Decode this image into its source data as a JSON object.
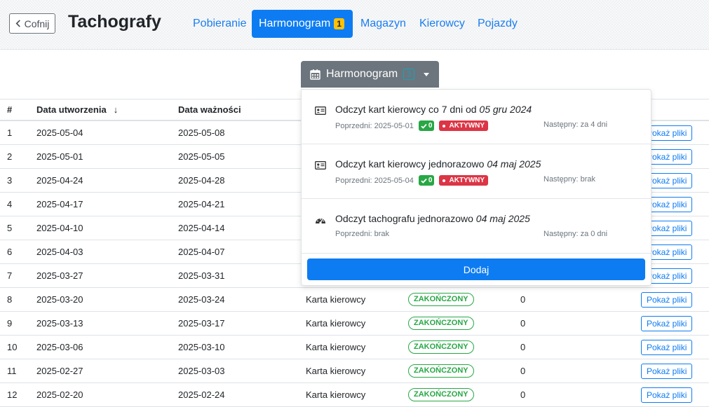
{
  "header": {
    "back_label": "Cofnij",
    "title": "Tachografy",
    "tabs": [
      {
        "label": "Pobieranie"
      },
      {
        "label": "Harmonogram",
        "badge": "1"
      },
      {
        "label": "Magazyn"
      },
      {
        "label": "Kierowcy"
      },
      {
        "label": "Pojazdy"
      }
    ]
  },
  "toolbar": {
    "harmonogram_label": "Harmonogram",
    "harmonogram_count": "3"
  },
  "table": {
    "headers": [
      "#",
      "Data utworzenia",
      "Data ważności"
    ],
    "sort_indicator": "↓",
    "rows": [
      {
        "n": "1",
        "created": "2025-05-04",
        "expires": "2025-05-08",
        "type": "",
        "status": "",
        "count": "",
        "files": "Pokaż pliki"
      },
      {
        "n": "2",
        "created": "2025-05-01",
        "expires": "2025-05-05",
        "type": "",
        "status": "",
        "count": "",
        "files": "Pokaż pliki"
      },
      {
        "n": "3",
        "created": "2025-04-24",
        "expires": "2025-04-28",
        "type": "",
        "status": "",
        "count": "",
        "files": "Pokaż pliki"
      },
      {
        "n": "4",
        "created": "2025-04-17",
        "expires": "2025-04-21",
        "type": "",
        "status": "",
        "count": "",
        "files": "Pokaż pliki"
      },
      {
        "n": "5",
        "created": "2025-04-10",
        "expires": "2025-04-14",
        "type": "",
        "status": "",
        "count": "",
        "files": "Pokaż pliki"
      },
      {
        "n": "6",
        "created": "2025-04-03",
        "expires": "2025-04-07",
        "type": "",
        "status": "",
        "count": "",
        "files": "Pokaż pliki"
      },
      {
        "n": "7",
        "created": "2025-03-27",
        "expires": "2025-03-31",
        "type": "",
        "status": "",
        "count": "",
        "files": "Pokaż pliki"
      },
      {
        "n": "8",
        "created": "2025-03-20",
        "expires": "2025-03-24",
        "type": "Karta kierowcy",
        "status": "ZAKOŃCZONY",
        "count": "0",
        "files": "Pokaż pliki"
      },
      {
        "n": "9",
        "created": "2025-03-13",
        "expires": "2025-03-17",
        "type": "Karta kierowcy",
        "status": "ZAKOŃCZONY",
        "count": "0",
        "files": "Pokaż pliki"
      },
      {
        "n": "10",
        "created": "2025-03-06",
        "expires": "2025-03-10",
        "type": "Karta kierowcy",
        "status": "ZAKOŃCZONY",
        "count": "0",
        "files": "Pokaż pliki"
      },
      {
        "n": "11",
        "created": "2025-02-27",
        "expires": "2025-03-03",
        "type": "Karta kierowcy",
        "status": "ZAKOŃCZONY",
        "count": "0",
        "files": "Pokaż pliki"
      },
      {
        "n": "12",
        "created": "2025-02-20",
        "expires": "2025-02-24",
        "type": "Karta kierowcy",
        "status": "ZAKOŃCZONY",
        "count": "0",
        "files": "Pokaż pliki"
      }
    ]
  },
  "dropdown": {
    "items": [
      {
        "icon": "id-card-icon",
        "title": "Odczyt kart kierowcy co 7 dni od ",
        "date": "05 gru 2024",
        "previous": "Poprzedni: 2025-05-01",
        "ok": "0",
        "active": "AKTYWNY",
        "next": "Następny: za 4 dni"
      },
      {
        "icon": "id-card-icon",
        "title": "Odczyt kart kierowcy jednorazowo ",
        "date": "04 maj 2025",
        "previous": "Poprzedni: 2025-05-04",
        "ok": "0",
        "active": "AKTYWNY",
        "next": "Następny: brak"
      },
      {
        "icon": "tachometer-icon",
        "title": "Odczyt tachografu jednorazowo ",
        "date": "04 maj 2025",
        "previous": "Poprzedni: brak",
        "ok": "",
        "active": "",
        "next": "Następny: za 0 dni"
      }
    ],
    "add_label": "Dodaj"
  }
}
